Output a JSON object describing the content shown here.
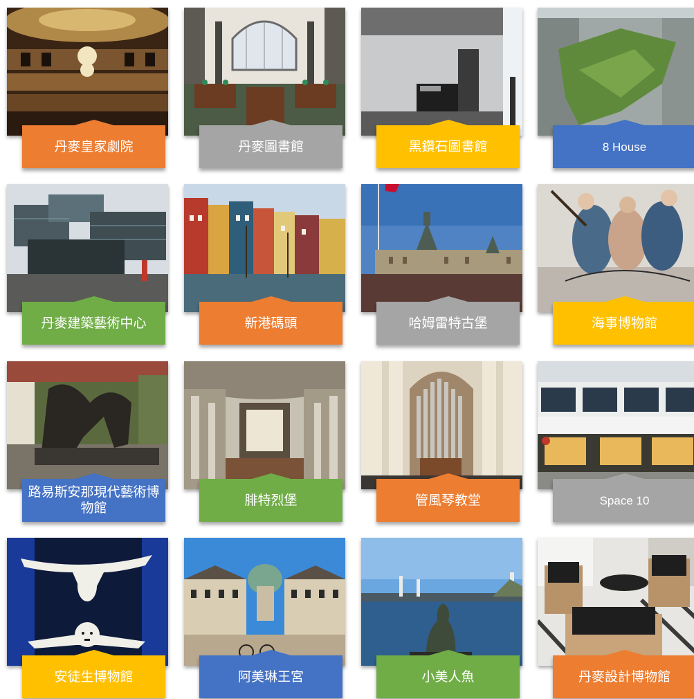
{
  "tiles": [
    {
      "label": "丹麥皇家劇院",
      "color": "#ed7d31",
      "photo": "royal-theatre-photo"
    },
    {
      "label": "丹麥圖書館",
      "color": "#a5a5a5",
      "photo": "library-reading-room-photo"
    },
    {
      "label": "黑鑽石圖書館",
      "color": "#ffc000",
      "photo": "black-diamond-library-photo"
    },
    {
      "label": "8 House",
      "color": "#4472c4",
      "photo": "8-house-aerial-photo"
    },
    {
      "label": "丹麥建築藝術中心",
      "color": "#70ad47",
      "photo": "danish-architecture-centre-photo"
    },
    {
      "label": "新港碼頭",
      "color": "#ed7d31",
      "photo": "nyhavn-harbour-photo"
    },
    {
      "label": "哈姆雷特古堡",
      "color": "#a5a5a5",
      "photo": "kronborg-castle-photo"
    },
    {
      "label": "海事博物館",
      "color": "#ffc000",
      "photo": "maritime-museum-figurehead-photo"
    },
    {
      "label": "路易斯安那現代藝術博物館",
      "color": "#4472c4",
      "photo": "louisiana-sculpture-photo"
    },
    {
      "label": "腓特烈堡",
      "color": "#70ad47",
      "photo": "frederiksborg-chapel-photo"
    },
    {
      "label": "管風琴教堂",
      "color": "#ed7d31",
      "photo": "grundtvig-church-organ-photo"
    },
    {
      "label": "Space 10",
      "color": "#a5a5a5",
      "photo": "space-10-building-photo"
    },
    {
      "label": "安徒生博物館",
      "color": "#ffc000",
      "photo": "andersen-museum-cutout-photo"
    },
    {
      "label": "阿美琳王宮",
      "color": "#4472c4",
      "photo": "amalienborg-palace-photo"
    },
    {
      "label": "小美人魚",
      "color": "#70ad47",
      "photo": "little-mermaid-statue-photo"
    },
    {
      "label": "丹麥設計博物館",
      "color": "#ed7d31",
      "photo": "design-museum-chairs-photo"
    }
  ]
}
